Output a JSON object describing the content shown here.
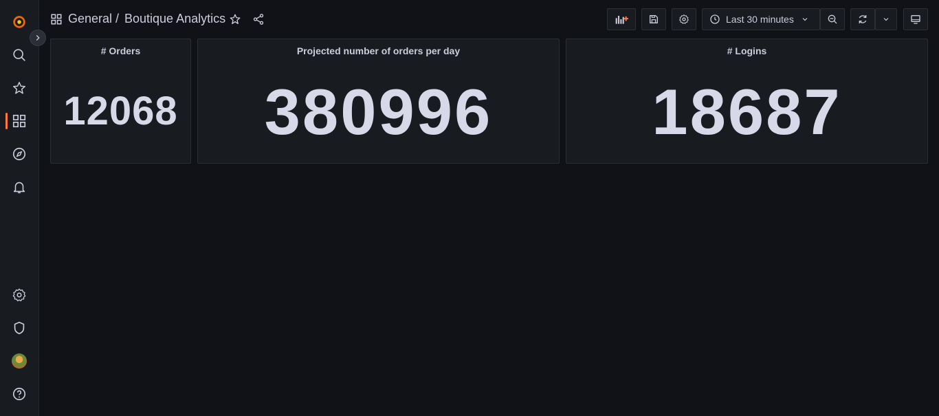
{
  "breadcrumb": {
    "folder": "General",
    "separator": "/",
    "dashboard": "Boutique Analytics"
  },
  "toolbar": {
    "time_range": "Last 30 minutes"
  },
  "panels": [
    {
      "title": "# Orders",
      "value": "12068"
    },
    {
      "title": "Projected number of orders per day",
      "value": "380996"
    },
    {
      "title": "# Logins",
      "value": "18687"
    }
  ],
  "colors": {
    "background": "#111217",
    "panel": "#181b1f",
    "accent": "#ff7941",
    "stat_text": "#d8d9e8"
  },
  "sidebar_icons": [
    "grafana-logo-icon",
    "search-icon",
    "star-icon",
    "dashboards-icon",
    "explore-icon",
    "alerting-icon",
    "settings-icon",
    "shield-icon",
    "avatar",
    "help-icon"
  ]
}
